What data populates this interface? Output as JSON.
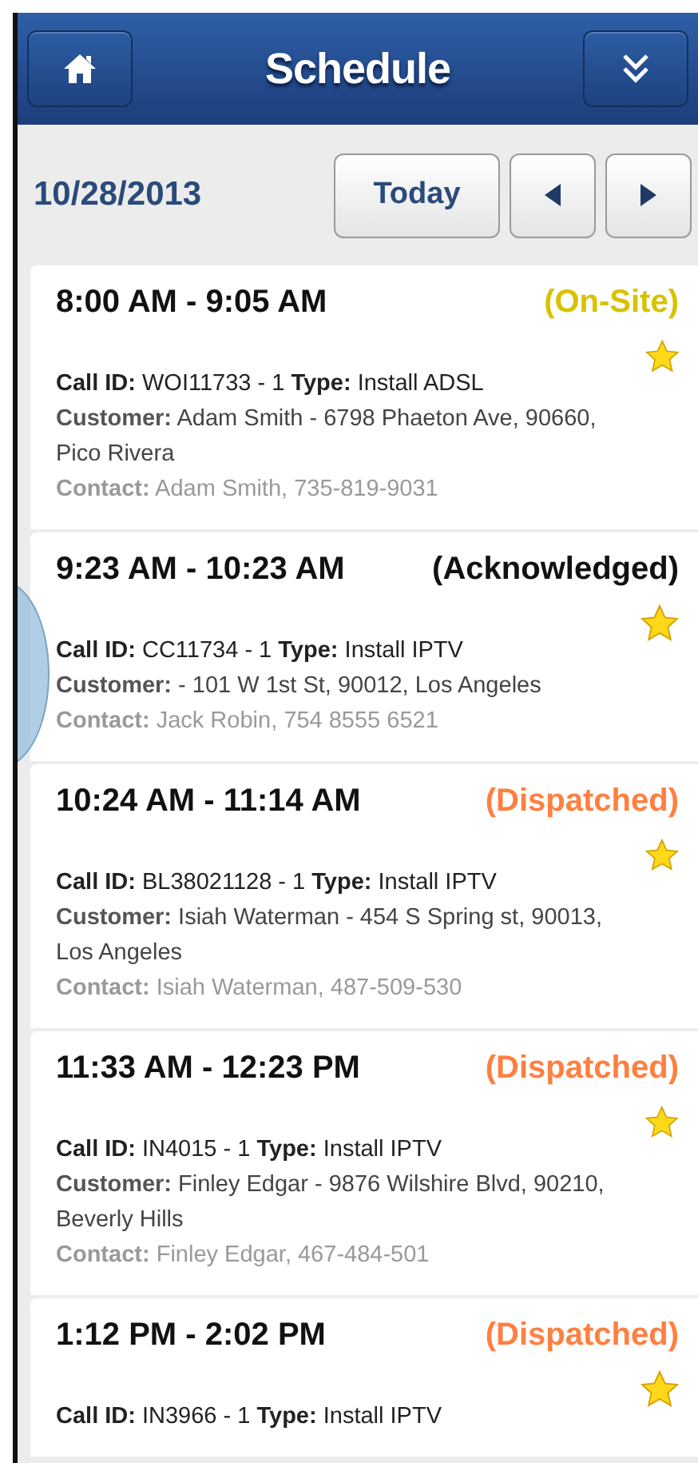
{
  "header": {
    "title": "Schedule"
  },
  "date_bar": {
    "date": "10/28/2013",
    "today_button": "Today"
  },
  "appointments": [
    {
      "time": "8:00 AM - 9:05 AM",
      "status": "(On-Site)",
      "color": "#d8c200",
      "starred": true,
      "call_line": "**Call ID:** WOI11733 - 1  **Type:** Install ADSL",
      "customer_line": "**Customer:**  Adam Smith - 6798 Phaeton Ave, 90660, Pico Rivera",
      "contact_line": "**Contact:**  Adam Smith, 735-819-9031"
    },
    {
      "time": "9:23 AM - 10:23 AM",
      "status": "(Acknowledged)",
      "color": "#111111",
      "starred": true,
      "call_line": "**Call ID:** CC11734 - 1  **Type:** Install IPTV",
      "customer_line": "**Customer:**   - 101 W 1st St, 90012, Los Angeles",
      "contact_line": "**Contact:**  Jack Robin, 754 8555 6521"
    },
    {
      "time": "10:24 AM - 11:14 AM",
      "status": "(Dispatched)",
      "color": "#ff7f40",
      "starred": true,
      "call_line": "**Call ID:** BL38021128 - 1  **Type:** Install IPTV",
      "customer_line": "**Customer:**  Isiah Waterman - 454 S Spring st, 90013, Los Angeles",
      "contact_line": "**Contact:**  Isiah Waterman, 487-509-530"
    },
    {
      "time": "11:33 AM - 12:23 PM",
      "status": "(Dispatched)",
      "color": "#ff7f40",
      "starred": true,
      "call_line": "**Call ID:** IN4015 - 1  **Type:** Install IPTV",
      "customer_line": "**Customer:**  Finley Edgar - 9876 Wilshire Blvd, 90210, Beverly Hills",
      "contact_line": "**Contact:**  Finley Edgar, 467-484-501"
    },
    {
      "time": "1:12 PM - 2:02 PM",
      "status": "(Dispatched)",
      "color": "#ff7f40",
      "starred": true,
      "call_line": "**Call ID:** IN3966 - 1  **Type:** Install IPTV"
    }
  ]
}
